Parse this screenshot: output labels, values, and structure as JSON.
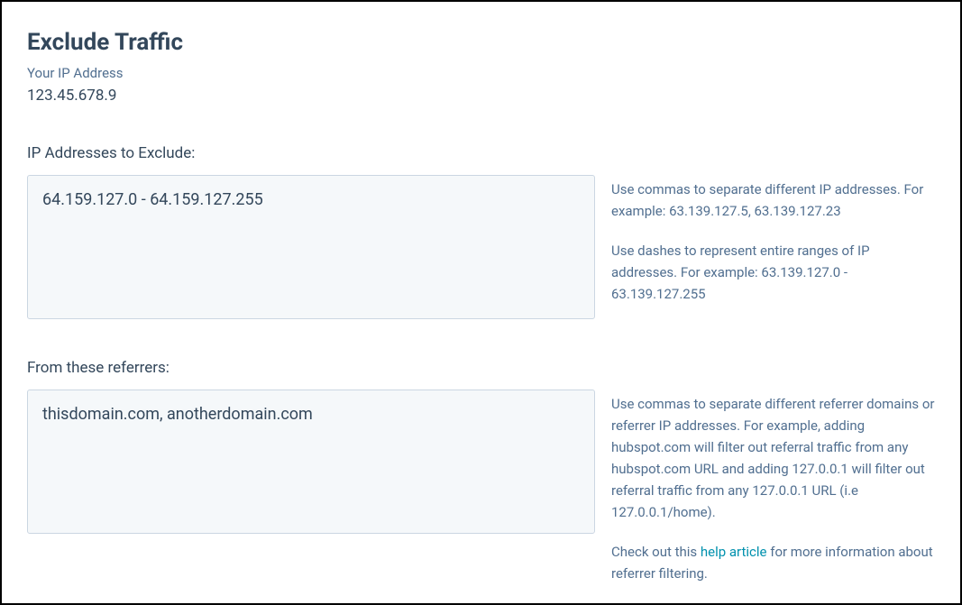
{
  "title": "Exclude Traffic",
  "ip_label": "Your IP Address",
  "ip_value": "123.45.678.9",
  "sections": {
    "ips": {
      "label": "IP Addresses to Exclude:",
      "value": "64.159.127.0 - 64.159.127.255",
      "help1": "Use commas to separate different IP addresses. For example: 63.139.127.5, 63.139.127.23",
      "help2": "Use dashes to represent entire ranges of IP addresses. For example: 63.139.127.0 - 63.139.127.255"
    },
    "referrers": {
      "label": "From these referrers:",
      "value": "thisdomain.com, anotherdomain.com",
      "help1": "Use commas to separate different referrer domains or referrer IP addresses. For example, adding hubspot.com will filter out referral traffic from any hubspot.com URL and adding 127.0.0.1 will filter out referral traffic from any 127.0.0.1 URL (i.e 127.0.0.1/home).",
      "help2_prefix": "Check out this ",
      "help2_link": "help article",
      "help2_suffix": " for more information about referrer filtering."
    }
  }
}
